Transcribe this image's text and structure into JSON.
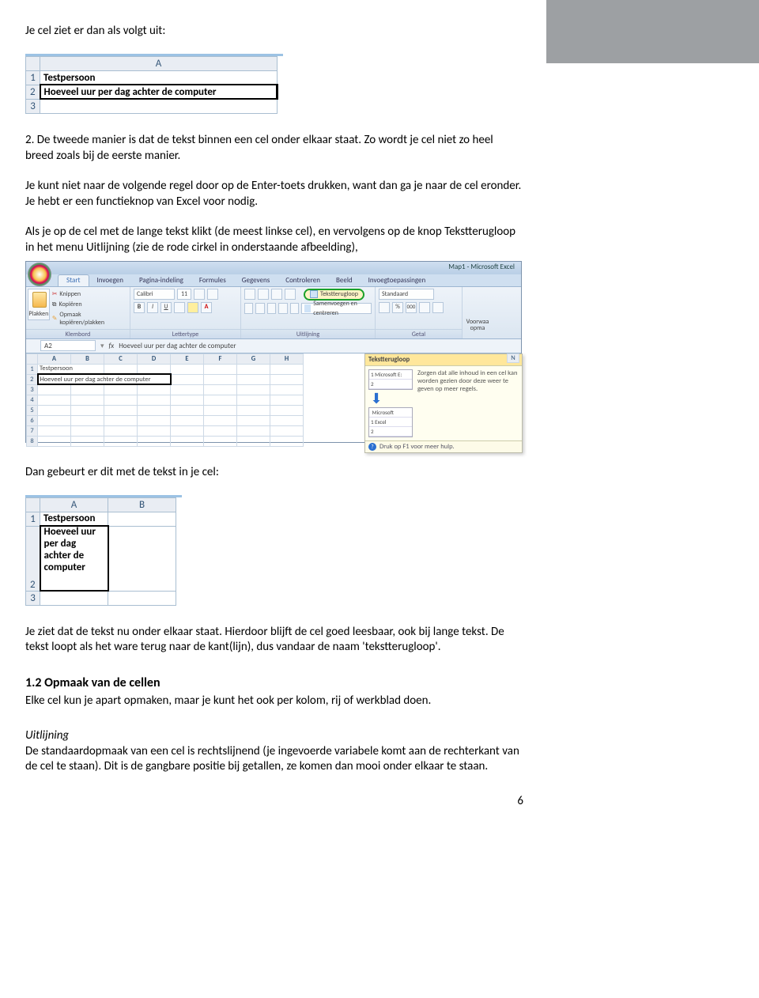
{
  "rt_band": true,
  "para1": "Je cel ziet er dan als volgt uit:",
  "fig1": {
    "col": "A",
    "rows": [
      "1",
      "2",
      "3"
    ],
    "r1": "Testpersoon",
    "r2": "Hoeveel uur per dag achter de computer"
  },
  "para2": "2. De tweede manier is dat de tekst binnen een cel onder elkaar staat. Zo wordt je cel niet zo heel breed zoals bij de eerste manier.",
  "para3": "Je kunt niet naar de volgende regel door op de Enter-toets drukken, want dan ga je naar de cel eronder. Je hebt er een functieknop van Excel voor nodig.",
  "para4": "Als je op de cel met de lange tekst klikt (de meest linkse cel), en vervolgens op de knop Tekstterugloop in het menu Uitlijning (zie de rode cirkel in onderstaande afbeelding),",
  "fig2": {
    "app_title": "Map1 - Microsoft Excel",
    "tabs": [
      "Start",
      "Invoegen",
      "Pagina-indeling",
      "Formules",
      "Gegevens",
      "Controleren",
      "Beeld",
      "Invoegtoepassingen"
    ],
    "groups": {
      "clipboard": {
        "label": "Klembord",
        "paste": "Plakken",
        "items": [
          "Knippen",
          "Kopiëren",
          "Opmaak kopiëren/plakken"
        ]
      },
      "font": {
        "label": "Lettertype",
        "name": "Calibri",
        "size": "11"
      },
      "alignment": {
        "label": "Uitlijning",
        "wrap": "Tekstterugloop",
        "merge": "Samenvoegen en centreren"
      },
      "number": {
        "label": "Getal",
        "fmt": "Standaard"
      },
      "styles": {
        "label1": "Voorwaa",
        "label2": "opma"
      }
    },
    "namebox": "A2",
    "formula": "Hoeveel uur per dag achter de computer",
    "cols": [
      "A",
      "B",
      "C",
      "D",
      "E",
      "F",
      "G",
      "H"
    ],
    "col_n": "N",
    "rows": [
      "1",
      "2",
      "3",
      "4",
      "5",
      "6",
      "7",
      "8"
    ],
    "r1": "Testpersoon",
    "r2": "Hoeveel uur per dag achter de computer",
    "tooltip": {
      "head": "Tekstterugloop",
      "desc": "Zorgen dat alle inhoud in een cel kan worden gezien door deze weer te geven op meer regels.",
      "preview": {
        "p1a": "1",
        "p1b": "Microsoft E:",
        "p2a": "2",
        "p2b": "",
        "p3a": "",
        "p3b": "Microsoft",
        "p4a": "1",
        "p4b": "Excel",
        "p5a": "2",
        "p5b": ""
      },
      "foot": "Druk op F1 voor meer hulp."
    }
  },
  "para5": "Dan gebeurt er dit met de tekst in je cel:",
  "fig3": {
    "cols": [
      "A",
      "B"
    ],
    "rows": [
      "1",
      "2",
      "3"
    ],
    "r1": "Testpersoon",
    "r2": "Hoeveel uur per dag achter de computer"
  },
  "para6": "Je ziet dat de tekst nu onder elkaar staat. Hierdoor blijft de cel goed leesbaar, ook bij lange tekst. De tekst loopt als het ware terug naar de kant(lijn), dus vandaar de naam 'tekstterugloop'.",
  "heading": "1.2 Opmaak van de cellen",
  "para7": "Elke cel kun je apart opmaken, maar je kunt het ook per kolom, rij of werkblad doen.",
  "para8_head": "Uitlijning",
  "para8": "De standaardopmaak van een cel is rechtslijnend (je ingevoerde variabele komt aan de rechterkant van de cel te staan). Dit is de gangbare positie bij getallen, ze komen dan mooi onder elkaar te staan.",
  "page_number": "6"
}
